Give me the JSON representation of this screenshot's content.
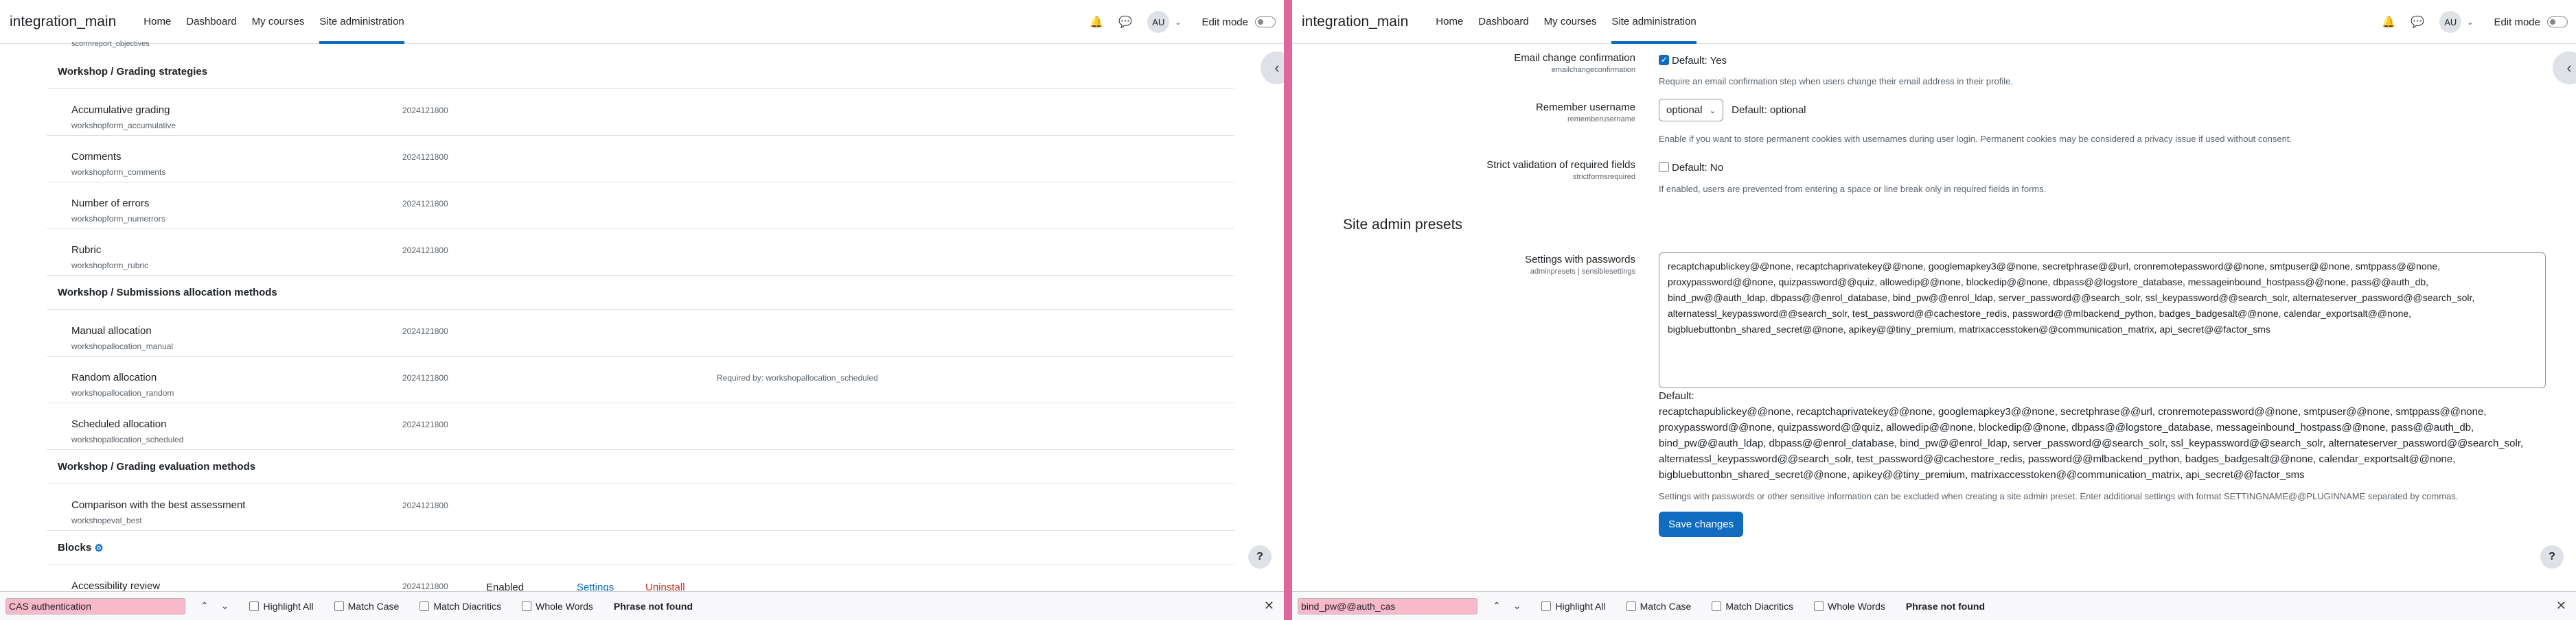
{
  "nav": {
    "brand": "integration_main",
    "links": [
      "Home",
      "Dashboard",
      "My courses",
      "Site administration"
    ],
    "avatar": "AU",
    "edit_mode": "Edit mode"
  },
  "left": {
    "top_partial": "scormreport_objectives",
    "sections": [
      {
        "title": "Workshop / Grading strategies",
        "rows": [
          {
            "name": "Accumulative grading",
            "key": "workshopform_accumulative",
            "version": "2024121800"
          },
          {
            "name": "Comments",
            "key": "workshopform_comments",
            "version": "2024121800"
          },
          {
            "name": "Number of errors",
            "key": "workshopform_numerrors",
            "version": "2024121800"
          },
          {
            "name": "Rubric",
            "key": "workshopform_rubric",
            "version": "2024121800"
          }
        ]
      },
      {
        "title": "Workshop / Submissions allocation methods",
        "rows": [
          {
            "name": "Manual allocation",
            "key": "workshopallocation_manual",
            "version": "2024121800"
          },
          {
            "name": "Random allocation",
            "key": "workshopallocation_random",
            "version": "2024121800",
            "required": "Required by: workshopallocation_scheduled"
          },
          {
            "name": "Scheduled allocation",
            "key": "workshopallocation_scheduled",
            "version": "2024121800"
          }
        ]
      },
      {
        "title": "Workshop / Grading evaluation methods",
        "rows": [
          {
            "name": "Comparison with the best assessment",
            "key": "workshopeval_best",
            "version": "2024121800"
          }
        ]
      }
    ],
    "blocks_title": "Blocks",
    "blocks_row": {
      "name": "Accessibility review",
      "version": "2024121800",
      "enabled": "Enabled",
      "settings": "Settings",
      "uninstall": "Uninstall"
    },
    "find": {
      "value": "CAS authentication"
    }
  },
  "right": {
    "email_change": {
      "label": "Email change confirmation",
      "key": "emailchangeconfirmation",
      "default": "Default: Yes",
      "desc": "Require an email confirmation step when users change their email address in their profile."
    },
    "remember": {
      "label": "Remember username",
      "key": "rememberusername",
      "value": "optional",
      "default": "Default: optional",
      "desc": "Enable if you want to store permanent cookies with usernames during user login. Permanent cookies may be considered a privacy issue if used without consent."
    },
    "strict": {
      "label": "Strict validation of required fields",
      "key": "strictformsrequired",
      "default": "Default: No",
      "desc": "If enabled, users are prevented from entering a space or line break only in required fields in forms."
    },
    "presets_heading": "Site admin presets",
    "passwords": {
      "label": "Settings with passwords",
      "key": "adminpresets | sensiblesettings",
      "lines": [
        "recaptchapublickey@@none, recaptchaprivatekey@@none, googlemapkey3@@none, secretphrase@@url, cronremotepassword@@none, smtpuser@@none, smtppass@@none,",
        "proxypassword@@none, quizpassword@@quiz, allowedip@@none, blockedip@@none, dbpass@@logstore_database, messageinbound_hostpass@@none, pass@@auth_db,",
        "bind_pw@@auth_ldap, dbpass@@enrol_database, bind_pw@@enrol_ldap, server_password@@search_solr, ssl_keypassword@@search_solr, alternateserver_password@@search_solr,",
        "alternatessl_keypassword@@search_solr, test_password@@cachestore_redis, password@@mlbackend_python, badges_badgesalt@@none, calendar_exportsalt@@none,",
        "bigbluebuttonbn_shared_secret@@none, apikey@@tiny_premium, matrixaccesstoken@@communication_matrix, api_secret@@factor_sms"
      ],
      "default_label": "Default:",
      "default_lines": [
        "recaptchapublickey@@none, recaptchaprivatekey@@none, googlemapkey3@@none, secretphrase@@url, cronremotepassword@@none, smtpuser@@none, smtppass@@none,",
        "proxypassword@@none, quizpassword@@quiz, allowedip@@none, blockedip@@none, dbpass@@logstore_database, messageinbound_hostpass@@none, pass@@auth_db,",
        "bind_pw@@auth_ldap, dbpass@@enrol_database, bind_pw@@enrol_ldap, server_password@@search_solr, ssl_keypassword@@search_solr, alternateserver_password@@search_solr,",
        "alternatessl_keypassword@@search_solr, test_password@@cachestore_redis, password@@mlbackend_python, badges_badgesalt@@none, calendar_exportsalt@@none,",
        "bigbluebuttonbn_shared_secret@@none, apikey@@tiny_premium, matrixaccesstoken@@communication_matrix, api_secret@@factor_sms"
      ],
      "desc": "Settings with passwords or other sensitive information can be excluded when creating a site admin preset. Enter additional settings with format SETTINGNAME@@PLUGINNAME separated by commas."
    },
    "save": "Save changes",
    "find": {
      "value": "bind_pw@@auth_cas"
    }
  },
  "findbar": {
    "highlight_all": "Highlight All",
    "match_case": "Match Case",
    "match_diacritics": "Match Diacritics",
    "whole_words": "Whole Words",
    "status": "Phrase not found"
  }
}
